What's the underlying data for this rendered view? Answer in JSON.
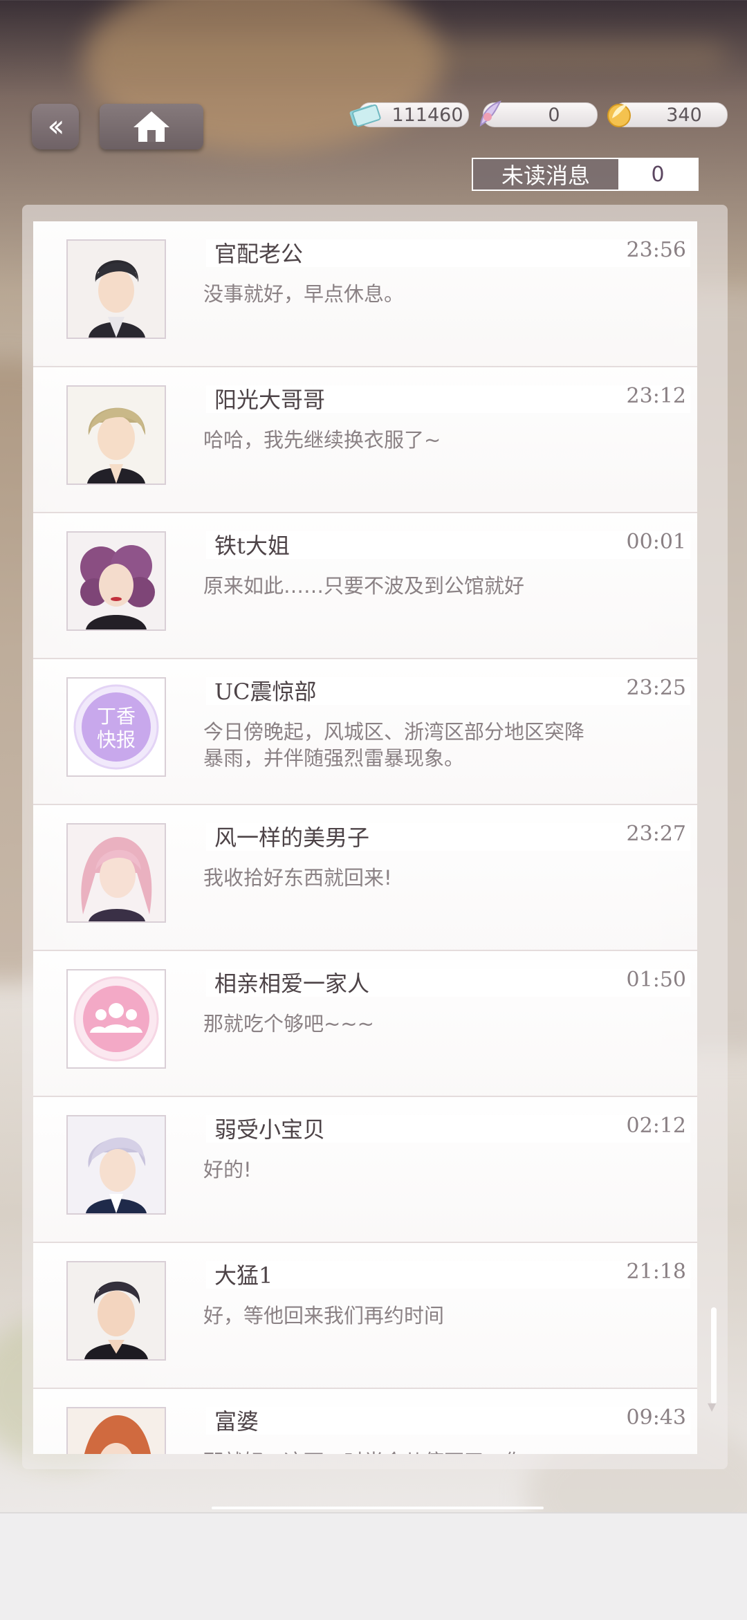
{
  "nav": {
    "back_icon": "double-chevron-left-icon",
    "home_icon": "home-icon"
  },
  "currency": [
    {
      "icon": "ticket-icon",
      "value": "111460"
    },
    {
      "icon": "feather-gem-icon",
      "value": "0"
    },
    {
      "icon": "gold-coin-icon",
      "value": "340"
    }
  ],
  "unread": {
    "label": "未读消息",
    "count": "0"
  },
  "chats": [
    {
      "name": "官配老公",
      "time": "23:56",
      "message": "没事就好，早点休息。",
      "avatar": "avatar-dark-hair-man"
    },
    {
      "name": "阳光大哥哥",
      "time": "23:12",
      "message": "哈哈，我先继续换衣服了~",
      "avatar": "avatar-blonde-man"
    },
    {
      "name": "铁t大姐",
      "time": "00:01",
      "message": "原来如此……只要不波及到公馆就好",
      "avatar": "avatar-purple-hair-woman"
    },
    {
      "name": "UC震惊部",
      "time": "23:25",
      "message": "今日傍晚起，风城区、浙湾区部分地区突降暴雨，并伴随强烈雷暴现象。",
      "avatar": "avatar-news-logo",
      "avatar_text": "丁香快报"
    },
    {
      "name": "风一样的美男子",
      "time": "23:27",
      "message": "我收拾好东西就回来!",
      "avatar": "avatar-pink-hair-man"
    },
    {
      "name": "相亲相爱一家人",
      "time": "01:50",
      "message": "那就吃个够吧~~~",
      "avatar": "avatar-group-icon"
    },
    {
      "name": "弱受小宝贝",
      "time": "02:12",
      "message": "好的!",
      "avatar": "avatar-silver-hair-man"
    },
    {
      "name": "大猛1",
      "time": "21:18",
      "message": "好，等他回来我们再约时间",
      "avatar": "avatar-short-hair-man"
    },
    {
      "name": "富婆",
      "time": "09:43",
      "message": "那就好，这下一时半会儿停不了，你",
      "avatar": "avatar-red-hair-woman"
    }
  ],
  "colors": {
    "accent": "#5b4660",
    "panel": "#f0ecec",
    "text": "#4d4347",
    "subtext": "#8a8184"
  }
}
